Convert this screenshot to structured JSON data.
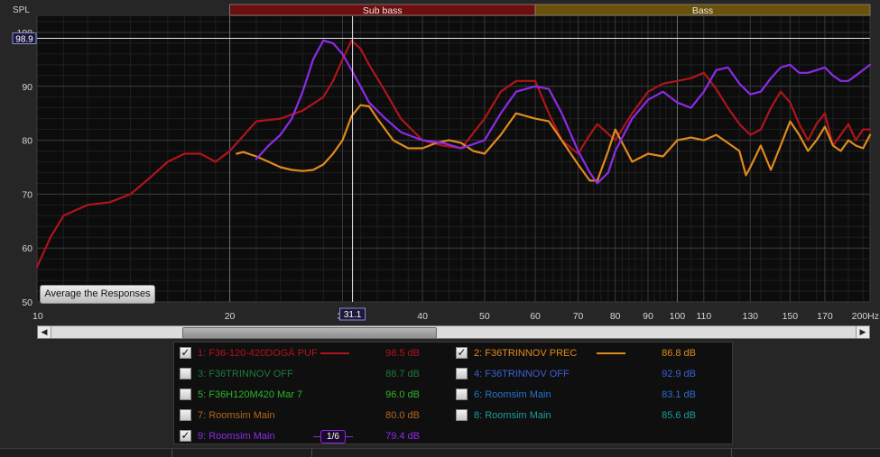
{
  "chart_data": {
    "type": "line",
    "y_axis_title": "SPL",
    "ylim": [
      50,
      103
    ],
    "yticks": [
      50,
      60,
      70,
      80,
      90,
      100
    ],
    "x_scale": "log",
    "xlim": [
      10,
      200
    ],
    "xtick_labels": [
      "10",
      "20",
      "30",
      "40",
      "50",
      "60",
      "70",
      "80",
      "90",
      "100",
      "110",
      "130",
      "150",
      "170",
      "200Hz"
    ],
    "xtick_values": [
      10,
      20,
      30,
      40,
      50,
      60,
      70,
      80,
      90,
      100,
      110,
      130,
      150,
      170,
      200
    ],
    "grid": true,
    "bands": [
      {
        "label": "Sub bass",
        "from": 20,
        "to": 60,
        "color": "#6e0d0d"
      },
      {
        "label": "Bass",
        "from": 60,
        "to": 200,
        "color": "#6a5208"
      }
    ],
    "cursor": {
      "x": 31.1,
      "x_label": "31.1",
      "y": 98.9,
      "y_label": "98.9"
    },
    "series": [
      {
        "name": "1: F36-120-420DOGÄ PUF",
        "color": "#b0141c",
        "x": [
          10,
          10.5,
          11,
          12,
          13,
          14,
          15,
          16,
          17,
          18,
          19,
          20,
          22,
          24,
          26,
          28,
          29,
          30,
          31,
          32,
          33,
          35,
          37,
          40,
          43,
          46,
          50,
          53,
          56,
          60,
          63,
          66,
          70,
          73,
          75,
          80,
          85,
          90,
          95,
          100,
          105,
          110,
          115,
          120,
          125,
          130,
          135,
          140,
          145,
          150,
          155,
          160,
          165,
          170,
          175,
          180,
          185,
          190,
          195,
          200
        ],
        "values": [
          56.5,
          62,
          66,
          68,
          68.5,
          70,
          73,
          76,
          77.5,
          77.5,
          76,
          78,
          83.5,
          84,
          85.5,
          88,
          91,
          95,
          98.5,
          97,
          94,
          89,
          84,
          80,
          79,
          78.5,
          84,
          89,
          91,
          91,
          85,
          80,
          77.5,
          81,
          83,
          80,
          85,
          89,
          90.5,
          91,
          91.5,
          92.5,
          89.5,
          86,
          83,
          81,
          82,
          86,
          89,
          87,
          83,
          80,
          83,
          85,
          79,
          81,
          83,
          80,
          82,
          82
        ]
      },
      {
        "name": "2: F36TRINNOV PREC",
        "color": "#e08a1c",
        "x": [
          20.5,
          21,
          22,
          23,
          24,
          25,
          26,
          27,
          28,
          29,
          30,
          31,
          32,
          33,
          34,
          36,
          38,
          40,
          42,
          44,
          46,
          48,
          50,
          53,
          56,
          60,
          63,
          66,
          70,
          73,
          75,
          78,
          80,
          85,
          90,
          95,
          100,
          105,
          110,
          115,
          120,
          125,
          128,
          130,
          135,
          140,
          145,
          150,
          155,
          160,
          165,
          170,
          175,
          180,
          185,
          190,
          195,
          200
        ],
        "values": [
          77.5,
          77.8,
          77,
          76,
          75,
          74.5,
          74.3,
          74.5,
          75.5,
          77.5,
          80,
          84.5,
          86.5,
          86.3,
          84,
          80,
          78.5,
          78.5,
          79.5,
          80,
          79.5,
          78,
          77.5,
          81,
          85,
          84,
          83.5,
          80,
          75.5,
          72.5,
          72.5,
          78,
          82,
          76,
          77.5,
          77,
          80,
          80.5,
          80,
          81,
          79.5,
          78,
          73.5,
          75,
          79,
          74.5,
          79,
          83.5,
          81,
          78,
          80,
          82.5,
          79,
          78,
          80,
          79,
          78.5,
          81
        ]
      },
      {
        "name": "9: Roomsim Main",
        "color": "#8b2be8",
        "x": [
          22,
          23,
          24,
          25,
          26,
          27,
          28,
          29,
          30,
          31,
          32,
          33,
          35,
          37,
          40,
          43,
          46,
          50,
          53,
          56,
          60,
          63,
          66,
          70,
          73,
          75,
          78,
          80,
          85,
          90,
          95,
          100,
          105,
          110,
          115,
          120,
          125,
          130,
          135,
          140,
          145,
          150,
          155,
          160,
          165,
          170,
          175,
          180,
          185,
          190,
          195,
          200
        ],
        "values": [
          76.5,
          79,
          81,
          84,
          89,
          95,
          98.5,
          98,
          96,
          93,
          90,
          87,
          84,
          81.5,
          80,
          79.5,
          78.5,
          80,
          85,
          89,
          90,
          89.5,
          85,
          78,
          74,
          72,
          74,
          78,
          84,
          87.5,
          89,
          87,
          86,
          89,
          93,
          93.5,
          90.5,
          88.5,
          89,
          91.5,
          93.5,
          94,
          92.5,
          92.5,
          93,
          93.5,
          92,
          91,
          91,
          92,
          93,
          94
        ]
      }
    ]
  },
  "ui": {
    "average_button": "Average the Responses",
    "scroll_left": "◀",
    "scroll_right": "▶"
  },
  "legend": {
    "items": [
      {
        "checked": true,
        "label": "1: F36-120-420DOGÄ PUF",
        "color": "#b0141c",
        "value": "98.5 dB"
      },
      {
        "checked": true,
        "label": "2: F36TRINNOV PREC",
        "color": "#e08a1c",
        "value": "86.8 dB"
      },
      {
        "checked": false,
        "label": "3: F36TRINNOV OFF",
        "color": "#1e7a3a",
        "value": "88.7 dB"
      },
      {
        "checked": false,
        "label": "4: F36TRINNOV OFF",
        "color": "#3b5fd6",
        "value": "92.9 dB"
      },
      {
        "checked": false,
        "label": "5: F36H120M420 Mar 7",
        "color": "#2bb52b",
        "value": "96.0 dB"
      },
      {
        "checked": false,
        "label": "6: Roomsim Main",
        "color": "#2a6fd0",
        "value": "83.1 dB"
      },
      {
        "checked": false,
        "label": "7: Roomsim Main",
        "color": "#b5651d",
        "value": "80.0 dB"
      },
      {
        "checked": false,
        "label": "8: Roomsim Main",
        "color": "#1e9a9a",
        "value": "85.6 dB"
      },
      {
        "checked": true,
        "label": "9: Roomsim Main",
        "color": "#8b2be8",
        "value": "79.4 dB",
        "smoothing": "1/6"
      }
    ]
  }
}
